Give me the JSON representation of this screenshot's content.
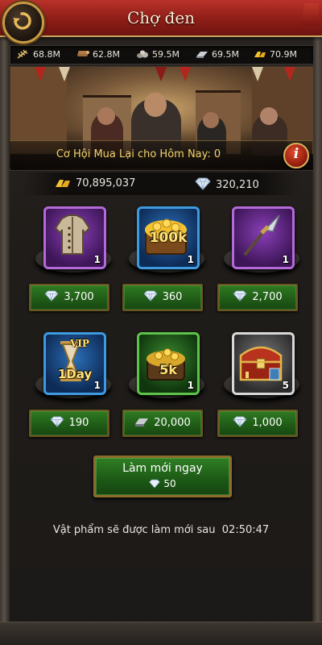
{
  "header": {
    "title": "Chợ đen"
  },
  "resources": [
    {
      "name": "food",
      "icon": "wheat-icon",
      "value": "68.8M"
    },
    {
      "name": "wood",
      "icon": "wood-icon",
      "value": "62.8M"
    },
    {
      "name": "stone",
      "icon": "stone-icon",
      "value": "59.5M"
    },
    {
      "name": "iron",
      "icon": "iron-icon",
      "value": "69.5M"
    },
    {
      "name": "gold",
      "icon": "gold-icon",
      "value": "70.9M"
    }
  ],
  "banner": {
    "rebuy_text": "Cơ Hội Mua Lại cho Hôm Nay: 0"
  },
  "totals": {
    "gold": "70,895,037",
    "gems": "320,210"
  },
  "items": [
    {
      "name": "armor",
      "icon": "armor-icon",
      "quantity": "1",
      "overlay": "",
      "price": "3,700",
      "currency": "gem-icon"
    },
    {
      "name": "gold-chest",
      "icon": "gold-coins-icon",
      "quantity": "1",
      "overlay": "100k",
      "price": "360",
      "currency": "gem-icon"
    },
    {
      "name": "spear",
      "icon": "spear-icon",
      "quantity": "1",
      "overlay": "",
      "price": "2,700",
      "currency": "gem-icon"
    },
    {
      "name": "vip-1day",
      "icon": "hourglass-icon",
      "quantity": "1",
      "overlay": "1Day",
      "overlay_top": "VIP",
      "price": "190",
      "currency": "gem-icon"
    },
    {
      "name": "gold-pile",
      "icon": "gold-coins-icon",
      "quantity": "1",
      "overlay": "5k",
      "price": "20,000",
      "currency": "iron-bar-icon"
    },
    {
      "name": "treasure-chest",
      "icon": "treasure-chest-icon",
      "quantity": "5",
      "overlay": "",
      "price": "1,000",
      "currency": "gem-icon"
    }
  ],
  "refresh": {
    "label": "Làm mới ngay",
    "cost": "50"
  },
  "refresh_note": "Vật phẩm sẽ được làm mới sau  02:50:47",
  "colors": {
    "header_red": "#9a231b",
    "price_green": "#2a6e1e",
    "gold_text": "#f2d36b"
  }
}
